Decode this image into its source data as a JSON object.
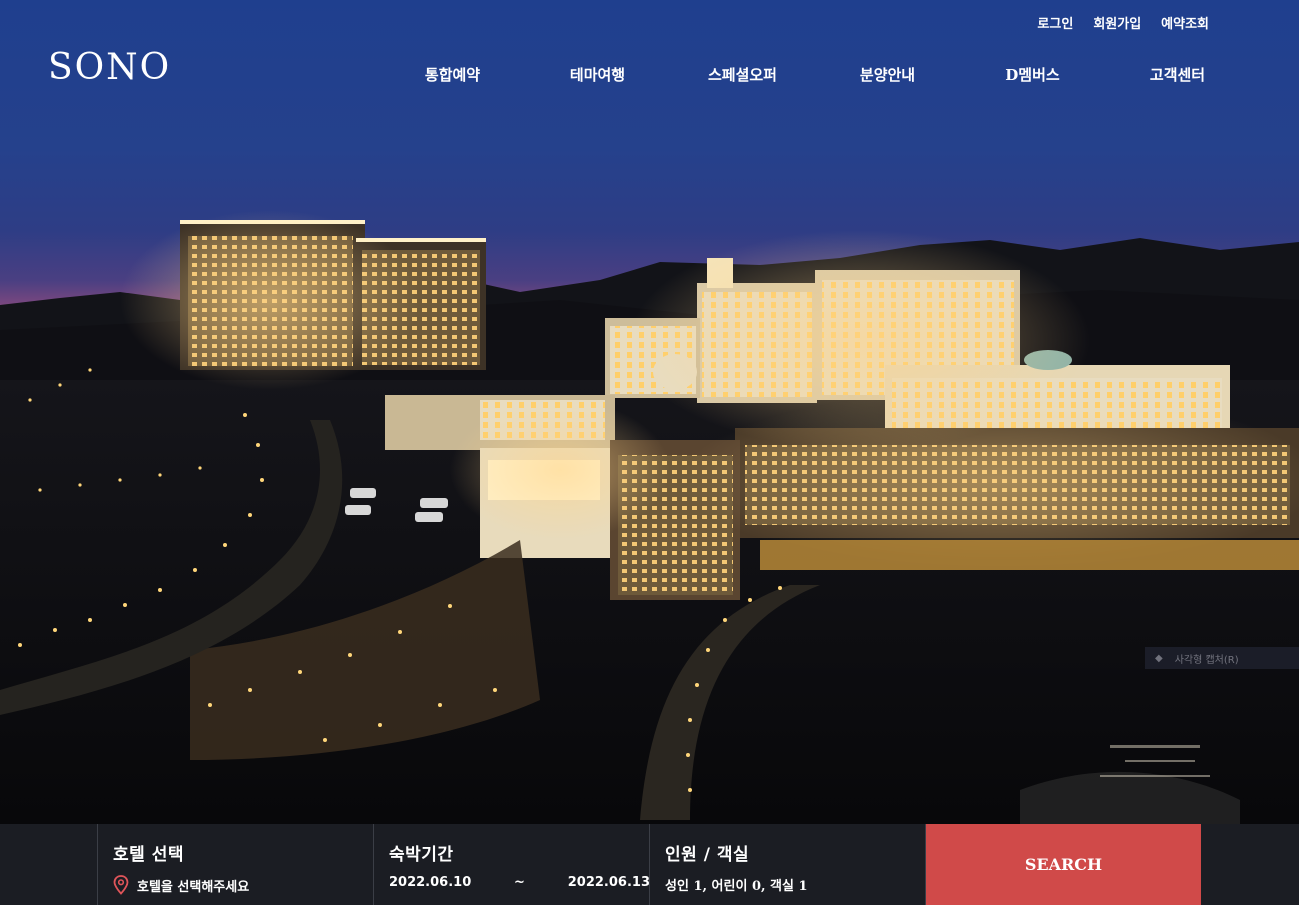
{
  "header": {
    "logo_text": "SONO",
    "util_links": [
      "로그인",
      "회원가입",
      "예약조회"
    ],
    "nav_items": [
      "통합예약",
      "테마여행",
      "스페셜오퍼",
      "분양안내",
      "D멤버스",
      "고객센터"
    ]
  },
  "overlay": {
    "capture_hint": "사각형 캡처(R)"
  },
  "booking": {
    "hotel": {
      "title": "호텔 선택",
      "placeholder": "호텔을 선택해주세요",
      "icon": "map-pin-icon"
    },
    "stay": {
      "title": "숙박기간",
      "check_in": "2022.06.10",
      "separator": "~",
      "check_out": "2022.06.13"
    },
    "guests": {
      "title": "인원 / 객실",
      "summary": "성인 1, 어린이 0, 객실 1"
    },
    "search_label": "SEARCH"
  },
  "colors": {
    "accent": "#d04a49",
    "booking_bg": "#1c1e24",
    "sky_top": "#1b3c86",
    "dusk": "#c45a7a"
  }
}
